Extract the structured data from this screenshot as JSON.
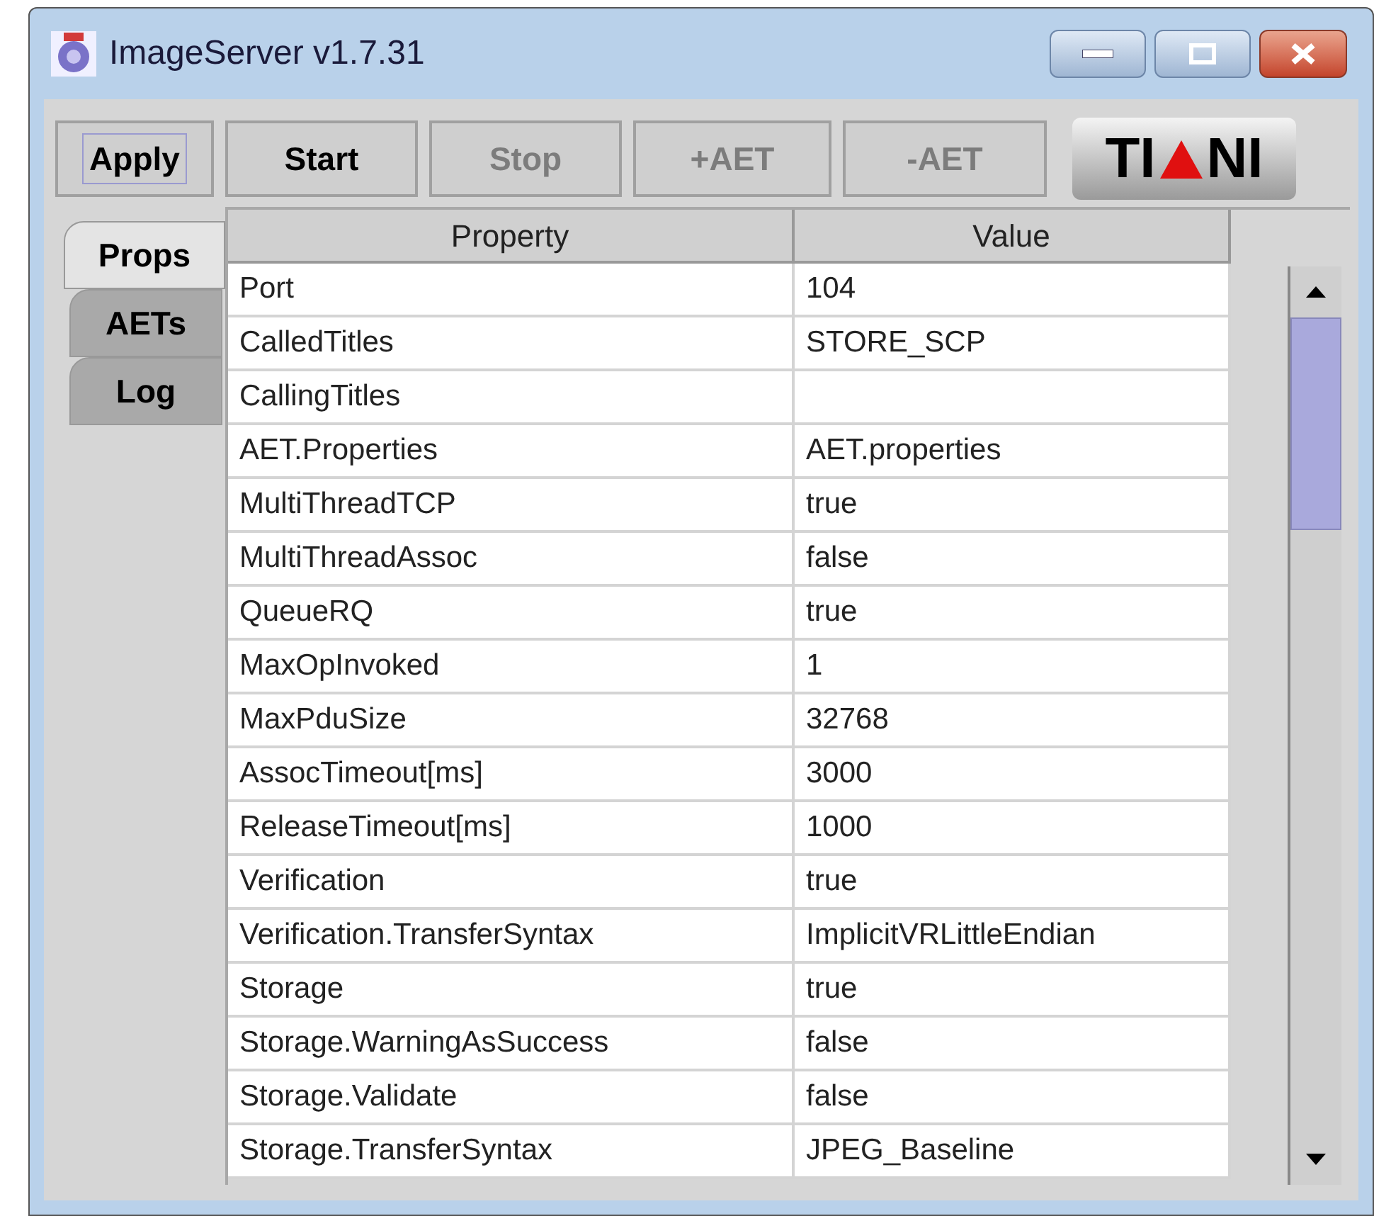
{
  "window": {
    "title": "ImageServer v1.7.31"
  },
  "toolbar": {
    "buttons": [
      {
        "label": "Apply",
        "disabled": false,
        "focused": true
      },
      {
        "label": "Start",
        "disabled": false,
        "focused": false
      },
      {
        "label": "Stop",
        "disabled": true,
        "focused": false
      },
      {
        "label": "+AET",
        "disabled": true,
        "focused": false
      },
      {
        "label": "-AET",
        "disabled": true,
        "focused": false
      }
    ],
    "logo": {
      "left": "TI",
      "right": "NI"
    }
  },
  "tabs": [
    {
      "label": "Props",
      "selected": true
    },
    {
      "label": "AETs",
      "selected": false
    },
    {
      "label": "Log",
      "selected": false
    }
  ],
  "table": {
    "columns": [
      "Property",
      "Value"
    ],
    "rows": [
      [
        "Port",
        "104"
      ],
      [
        "CalledTitles",
        "STORE_SCP"
      ],
      [
        "CallingTitles",
        ""
      ],
      [
        "AET.Properties",
        "AET.properties"
      ],
      [
        "MultiThreadTCP",
        "true"
      ],
      [
        "MultiThreadAssoc",
        "false"
      ],
      [
        "QueueRQ",
        "true"
      ],
      [
        "MaxOpInvoked",
        "1"
      ],
      [
        "MaxPduSize",
        "32768"
      ],
      [
        "AssocTimeout[ms]",
        "3000"
      ],
      [
        "ReleaseTimeout[ms]",
        "1000"
      ],
      [
        "Verification",
        "true"
      ],
      [
        "Verification.TransferSyntax",
        "ImplicitVRLittleEndian"
      ],
      [
        "Storage",
        "true"
      ],
      [
        "Storage.WarningAsSuccess",
        "false"
      ],
      [
        "Storage.Validate",
        "false"
      ],
      [
        "Storage.TransferSyntax",
        "JPEG_Baseline"
      ]
    ]
  }
}
